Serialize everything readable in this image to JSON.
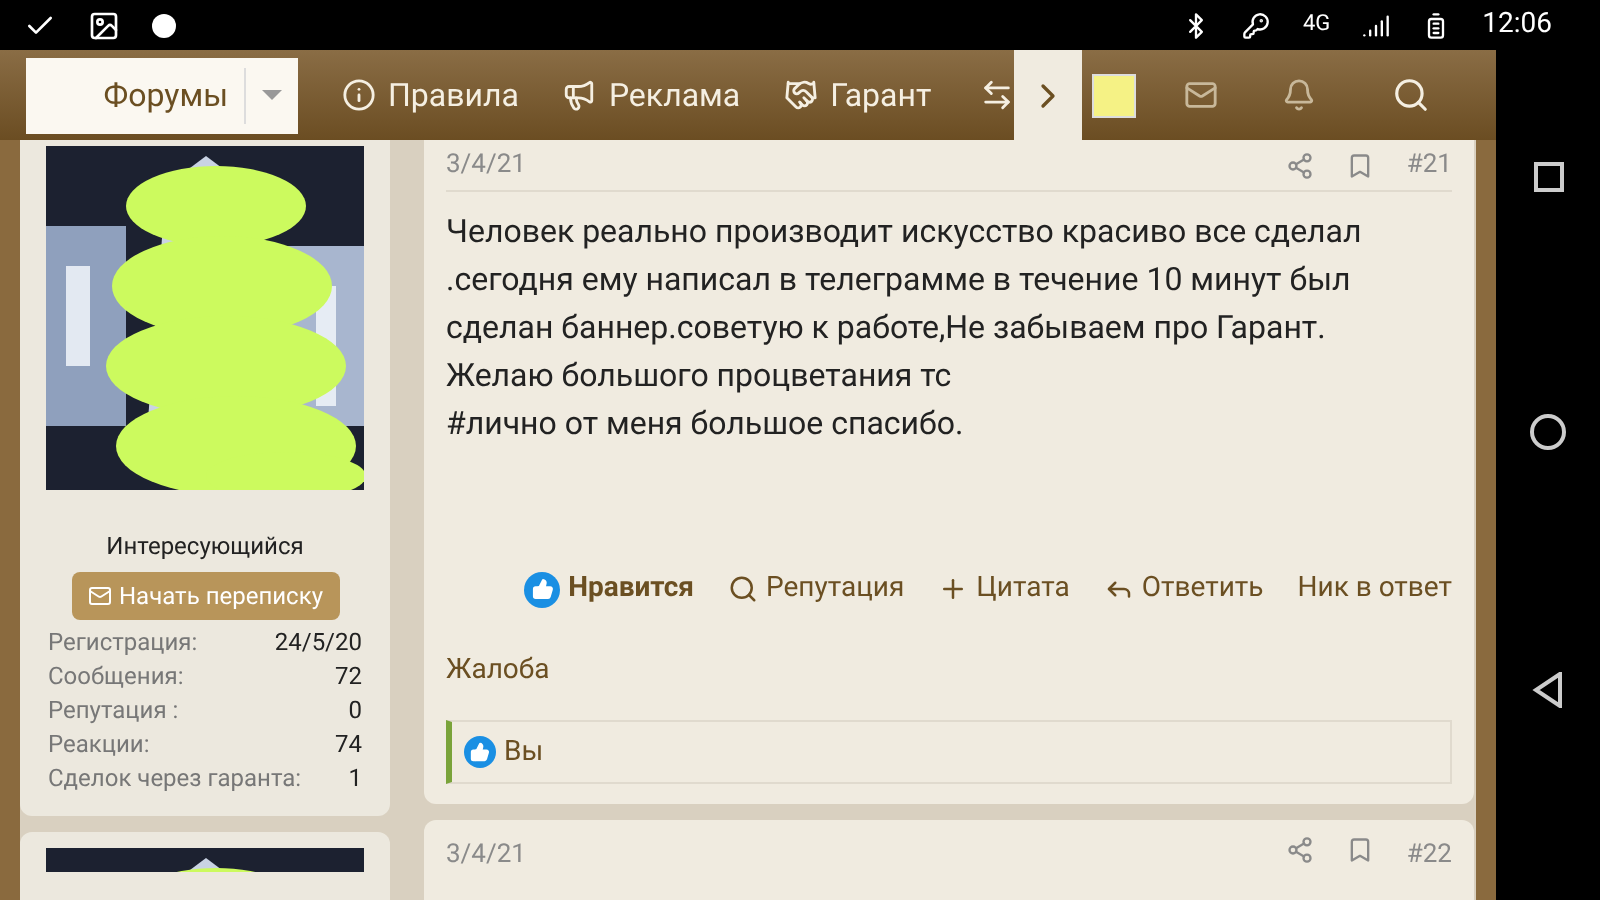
{
  "status_bar": {
    "network": "4G",
    "time": "12:06"
  },
  "nav": {
    "forums": {
      "label": "Форумы",
      "selected": true
    },
    "items": [
      {
        "kind": "info",
        "label": "Правила"
      },
      {
        "kind": "megaphone",
        "label": "Реклама"
      },
      {
        "kind": "handshake",
        "label": "Гарант"
      }
    ]
  },
  "posts": [
    {
      "user": {
        "title": "Интересующийся",
        "message_button": "Начать переписку",
        "stats": [
          {
            "label": "Регистрация:",
            "value": "24/5/20"
          },
          {
            "label": "Сообщения:",
            "value": "72"
          },
          {
            "label": "Репутация :",
            "value": "0"
          },
          {
            "label": "Реакции:",
            "value": "74"
          },
          {
            "label": "Сделок через гаранта:",
            "value": "1"
          }
        ]
      },
      "date": "3/4/21",
      "number": "#21",
      "body": [
        "Человек реально производит искусство красиво все сделал",
        ".сегодня ему написал в телеграмме в течение 10 минут был",
        "сделан баннер.советую к работе,Не забываем про Гарант.",
        "Желаю большого процветания тс",
        "#лично от меня большое спасибо."
      ],
      "actions": [
        {
          "kind": "like",
          "label": "Нравится",
          "liked": true
        },
        {
          "kind": "search",
          "label": "Репутация"
        },
        {
          "kind": "plus",
          "label": "Цитата"
        },
        {
          "kind": "reply",
          "label": "Ответить"
        },
        {
          "kind": "plain",
          "label": "Ник в ответ"
        }
      ],
      "report": "Жалоба",
      "reactions": "Вы"
    },
    {
      "date": "3/4/21",
      "number": "#22"
    }
  ]
}
